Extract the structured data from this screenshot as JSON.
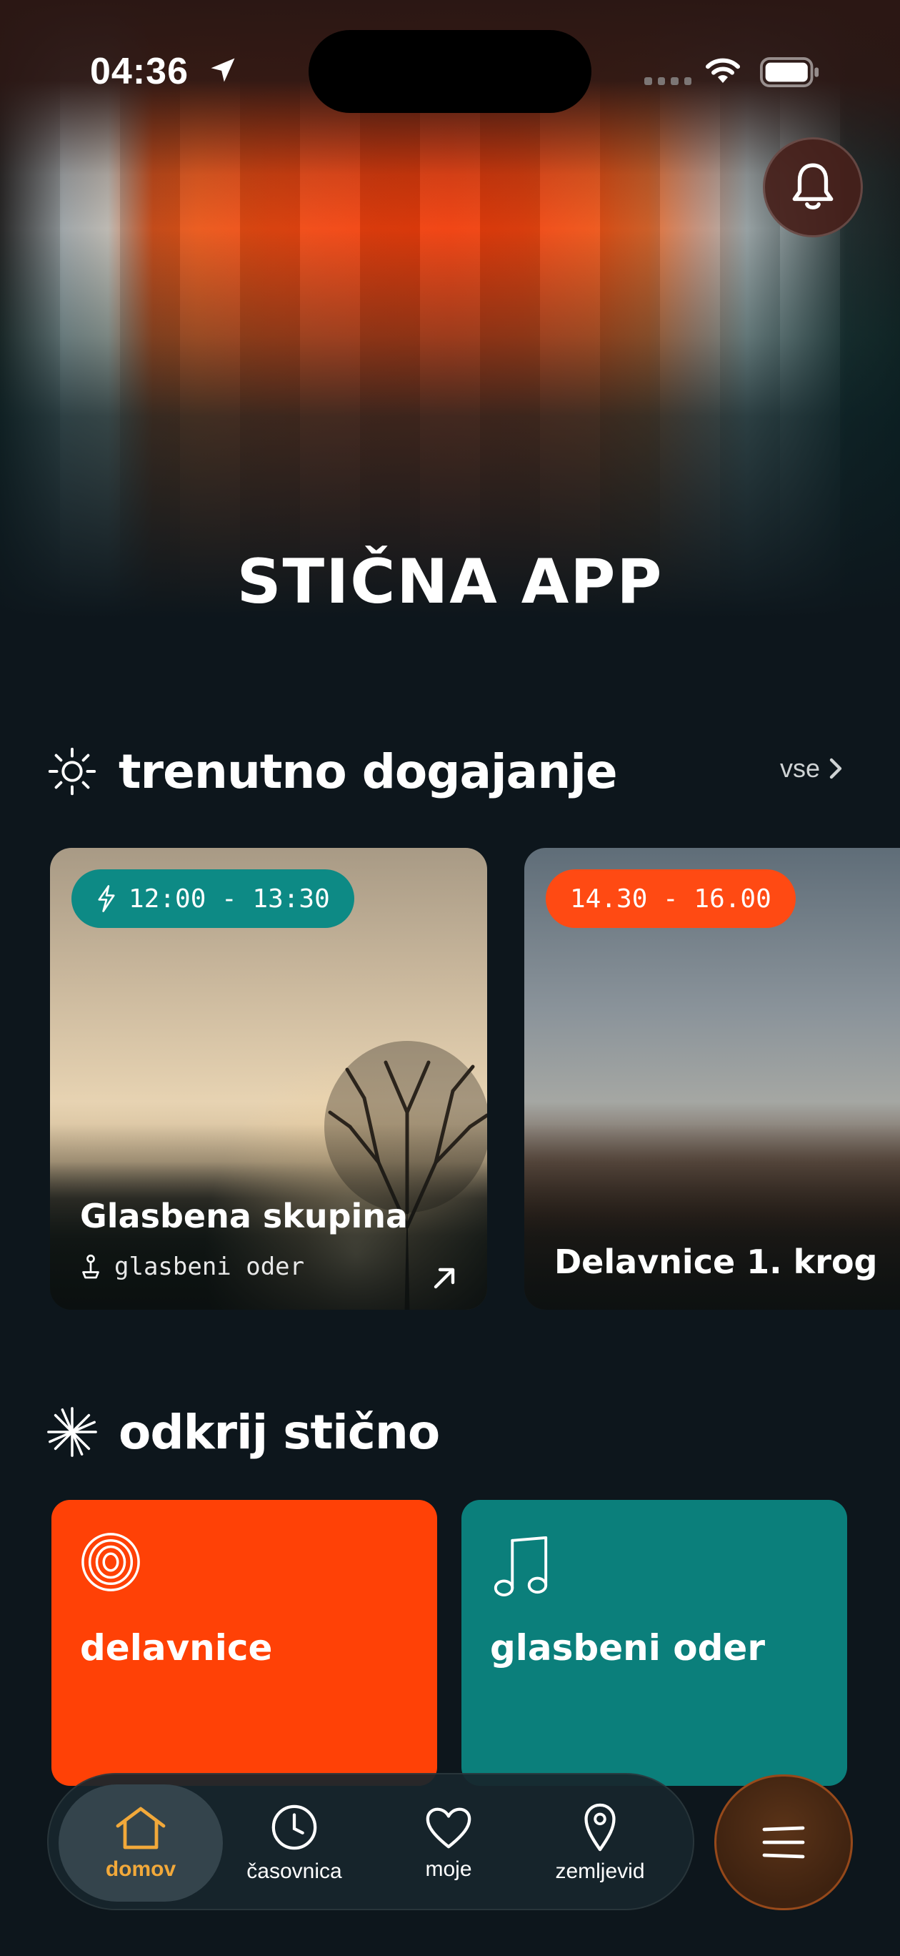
{
  "status_bar": {
    "time": "04:36"
  },
  "header": {
    "app_title": "STIČNA APP"
  },
  "current_events": {
    "title": "trenutno dogajanje",
    "see_all": "vse",
    "cards": [
      {
        "time": "12:00 - 13:30",
        "title": "Glasbena skupina",
        "location": "glasbeni oder"
      },
      {
        "time": "14.30 - 16.00",
        "title": "Delavnice 1. krog"
      }
    ]
  },
  "discover": {
    "title": "odkrij stično",
    "tiles": [
      {
        "label": "delavnice",
        "color": "#ff4106"
      },
      {
        "label": "glasbeni oder",
        "color": "#0b7f7b"
      }
    ]
  },
  "bottom_nav": {
    "items": [
      {
        "label": "domov",
        "icon": "home-icon",
        "active": true
      },
      {
        "label": "časovnica",
        "icon": "clock-icon"
      },
      {
        "label": "moje",
        "icon": "heart-icon"
      },
      {
        "label": "zemljevid",
        "icon": "map-pin-icon"
      }
    ],
    "menu_icon": "menu-icon"
  },
  "colors": {
    "accent_orange": "#ff4a13",
    "accent_teal": "#0d8a85",
    "active_nav": "#f2a93a",
    "background": "#0d161c"
  }
}
